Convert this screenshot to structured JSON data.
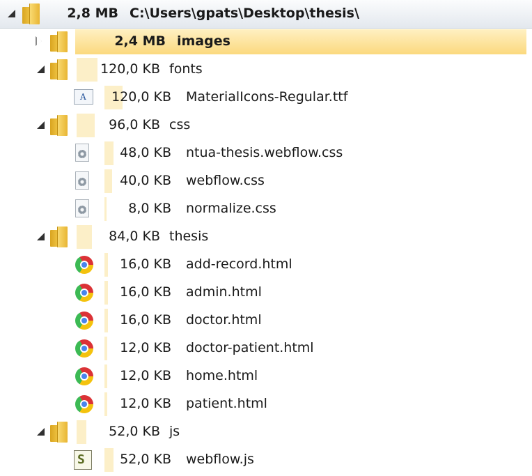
{
  "tree": {
    "root": {
      "size": "2,8 MB",
      "name": "C:\\Users\\gpats\\Desktop\\thesis\\",
      "expanded": true,
      "icon": "folder-icon"
    },
    "images": {
      "size": "2,4 MB",
      "name": "images",
      "expanded": false,
      "selected": true,
      "icon": "folder-icon"
    },
    "fonts": {
      "size": "120,0 KB",
      "name": "fonts",
      "expanded": true,
      "icon": "folder-icon",
      "files": [
        {
          "size": "120,0 KB",
          "name": "MaterialIcons-Regular.ttf",
          "icon": "font-file-icon"
        }
      ]
    },
    "css": {
      "size": "96,0 KB",
      "name": "css",
      "expanded": true,
      "icon": "folder-icon",
      "files": [
        {
          "size": "48,0 KB",
          "name": "ntua-thesis.webflow.css",
          "icon": "css-file-icon"
        },
        {
          "size": "40,0 KB",
          "name": "webflow.css",
          "icon": "css-file-icon"
        },
        {
          "size": "8,0 KB",
          "name": "normalize.css",
          "icon": "css-file-icon"
        }
      ]
    },
    "thesis": {
      "size": "84,0 KB",
      "name": "thesis",
      "expanded": true,
      "icon": "folder-icon",
      "files": [
        {
          "size": "16,0 KB",
          "name": "add-record.html",
          "icon": "chrome-icon"
        },
        {
          "size": "16,0 KB",
          "name": "admin.html",
          "icon": "chrome-icon"
        },
        {
          "size": "16,0 KB",
          "name": "doctor.html",
          "icon": "chrome-icon"
        },
        {
          "size": "12,0 KB",
          "name": "doctor-patient.html",
          "icon": "chrome-icon"
        },
        {
          "size": "12,0 KB",
          "name": "home.html",
          "icon": "chrome-icon"
        },
        {
          "size": "12,0 KB",
          "name": "patient.html",
          "icon": "chrome-icon"
        }
      ]
    },
    "js": {
      "size": "52,0 KB",
      "name": "js",
      "expanded": true,
      "icon": "folder-icon",
      "files": [
        {
          "size": "52,0 KB",
          "name": "webflow.js",
          "icon": "js-file-icon"
        }
      ]
    }
  },
  "colors": {
    "selection": "#fbd97e",
    "size_bar": "#fcefc8",
    "header": "#e3e8ee"
  }
}
